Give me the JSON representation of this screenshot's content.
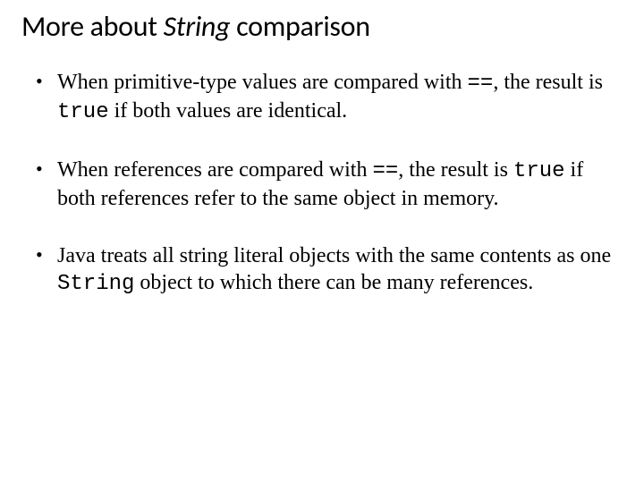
{
  "title": {
    "pre": "More about ",
    "italic": "String",
    "post": " comparison"
  },
  "bullets": [
    {
      "t0": "When primitive-type values are compared with ",
      "c0": "==",
      "t1": ", the result is ",
      "c1": "true",
      "t2": " if both values are identical."
    },
    {
      "t0": "When references are compared with ",
      "c0": "==",
      "t1": ", the result is ",
      "c1": "true",
      "t2": " if both references refer to the same object in memory."
    },
    {
      "t0": "Java treats all string literal objects with the same contents as one ",
      "c0": "String",
      "t1": " object to which there can be many references.",
      "c1": "",
      "t2": ""
    }
  ]
}
